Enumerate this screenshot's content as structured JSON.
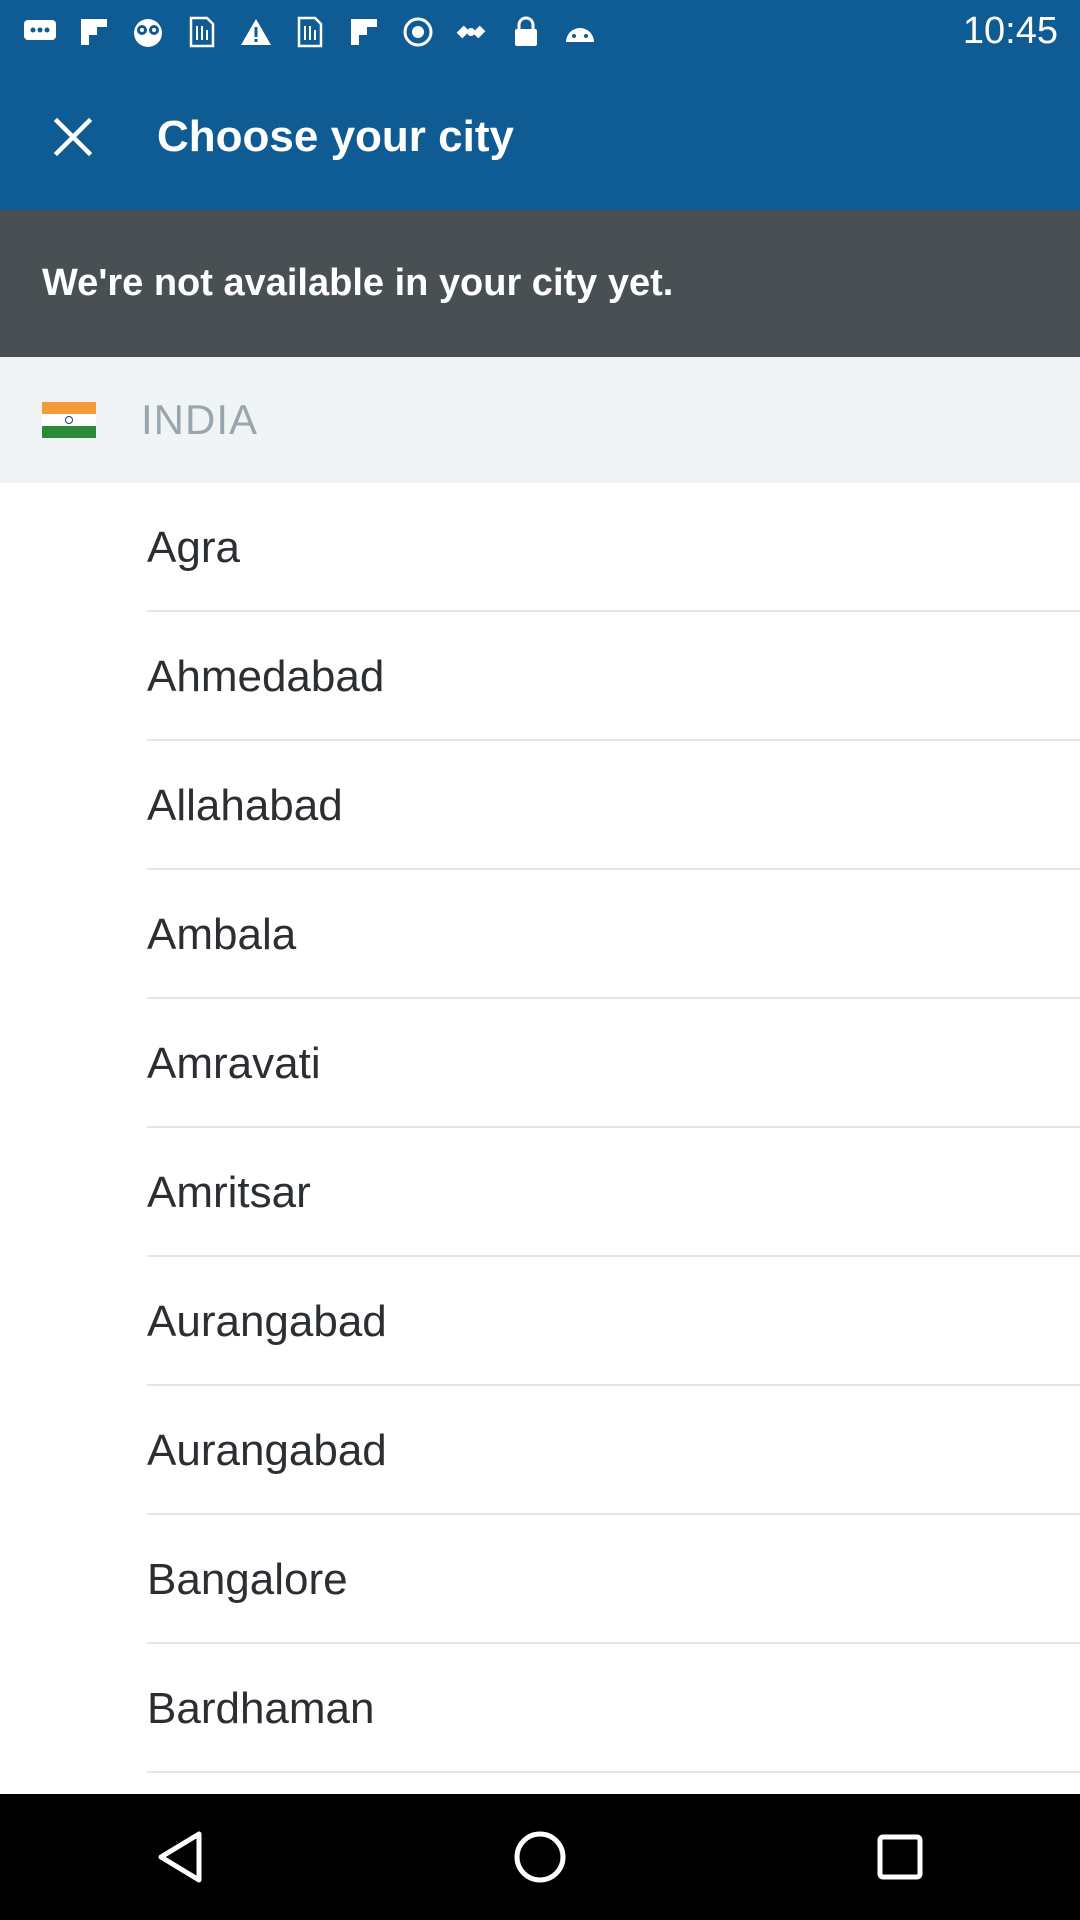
{
  "status_bar": {
    "time": "10:45",
    "icons": [
      "chat-icon",
      "flipboard-icon",
      "owl-icon",
      "sim-icon",
      "warning-icon",
      "sim-icon",
      "flipboard-icon",
      "settings-icon",
      "satellite-icon",
      "lock-icon",
      "android-icon"
    ]
  },
  "app_bar": {
    "title": "Choose your city",
    "background": "#0f5b94"
  },
  "notice": {
    "text": "We're not available in your city yet.",
    "background": "#495053"
  },
  "country": {
    "name": "INDIA",
    "flag_icon": "india-flag-icon"
  },
  "cities": [
    {
      "label": "Agra"
    },
    {
      "label": "Ahmedabad"
    },
    {
      "label": "Allahabad"
    },
    {
      "label": "Ambala"
    },
    {
      "label": "Amravati"
    },
    {
      "label": "Amritsar"
    },
    {
      "label": "Aurangabad"
    },
    {
      "label": "Aurangabad"
    },
    {
      "label": "Bangalore"
    },
    {
      "label": "Bardhaman"
    }
  ],
  "nav": {
    "back": "back-icon",
    "home": "home-icon",
    "recents": "recents-icon"
  }
}
